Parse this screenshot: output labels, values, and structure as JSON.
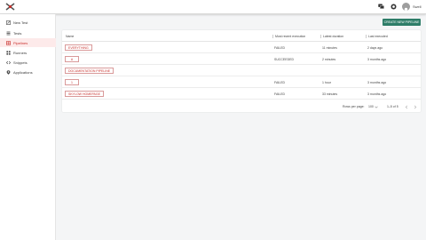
{
  "header": {
    "user_name": "Swell"
  },
  "sidebar": {
    "items": [
      {
        "label": "New Test",
        "icon": "new-test-icon"
      },
      {
        "label": "Tests",
        "icon": "tests-icon"
      },
      {
        "label": "Pipelines",
        "icon": "pipelines-icon",
        "active": true
      },
      {
        "label": "Runners",
        "icon": "runners-icon"
      },
      {
        "label": "Snippets",
        "icon": "snippets-icon"
      },
      {
        "label": "Applications",
        "icon": "applications-icon"
      }
    ]
  },
  "toolbar": {
    "create_label": "CREATE NEW PIPELINE"
  },
  "table": {
    "columns": [
      "Name",
      "Most recent execution",
      "Latest duration",
      "Last executed"
    ],
    "rows": [
      {
        "name": "EVERYTHING",
        "status": "FAILED",
        "duration": "11 minutes",
        "last": "2 days ago"
      },
      {
        "name": "A",
        "status": "SUCCEEDED",
        "duration": "2 minutes",
        "last": "3 months ago"
      },
      {
        "name": "DOCUMENTATION PIPELINE",
        "status": "",
        "duration": "",
        "last": ""
      },
      {
        "name": "1",
        "status": "FAILED",
        "duration": "1 hour",
        "last": "3 months ago"
      },
      {
        "name": "SKYLOW HOMEPAGE",
        "status": "FAILED",
        "duration": "33 minutes",
        "last": "3 months ago"
      }
    ]
  },
  "pagination": {
    "rows_label": "Rows per page:",
    "rows_value": "100",
    "range": "1–5 of 5"
  },
  "colors": {
    "accent": "#c9302c",
    "primary_button": "#2e7d68"
  }
}
